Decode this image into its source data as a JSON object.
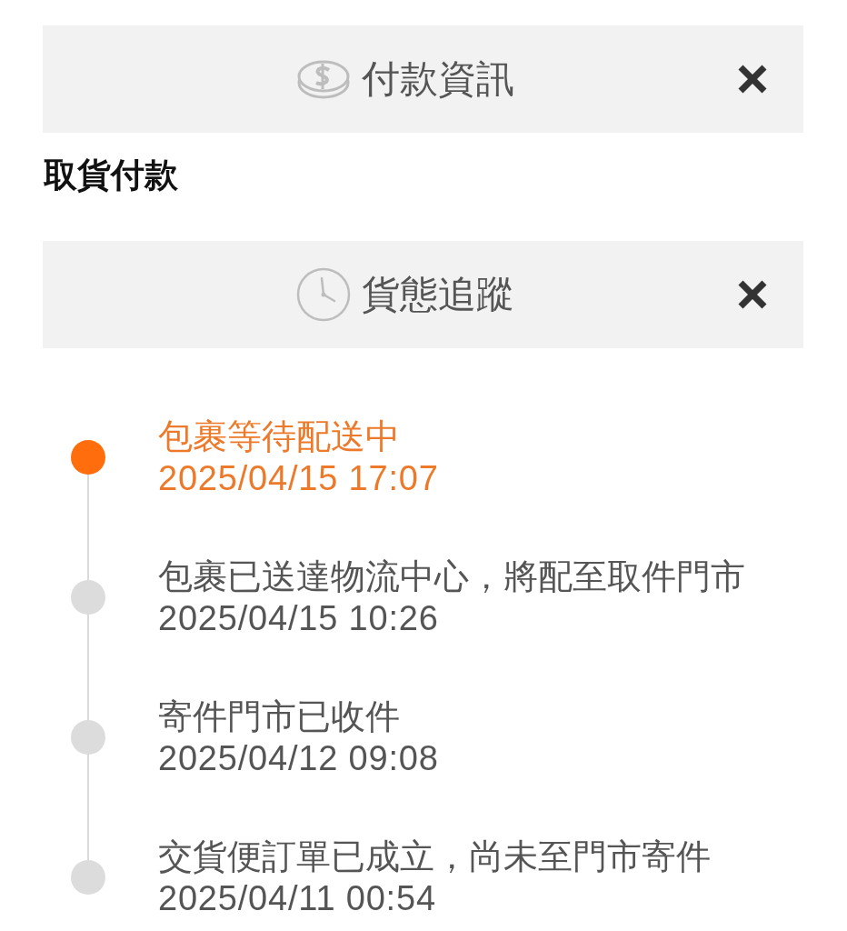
{
  "payment_panel": {
    "title": "付款資訊"
  },
  "payment_method": "取貨付款",
  "tracking_panel": {
    "title": "貨態追蹤"
  },
  "tracking_events": [
    {
      "status": "包裹等待配送中",
      "time": "2025/04/15 17:07",
      "active": true
    },
    {
      "status": "包裹已送達物流中心，將配至取件門市",
      "time": "2025/04/15 10:26",
      "active": false
    },
    {
      "status": "寄件門市已收件",
      "time": "2025/04/12 09:08",
      "active": false
    },
    {
      "status": "交貨便訂單已成立，尚未至門市寄件",
      "time": "2025/04/11 00:54",
      "active": false
    }
  ]
}
